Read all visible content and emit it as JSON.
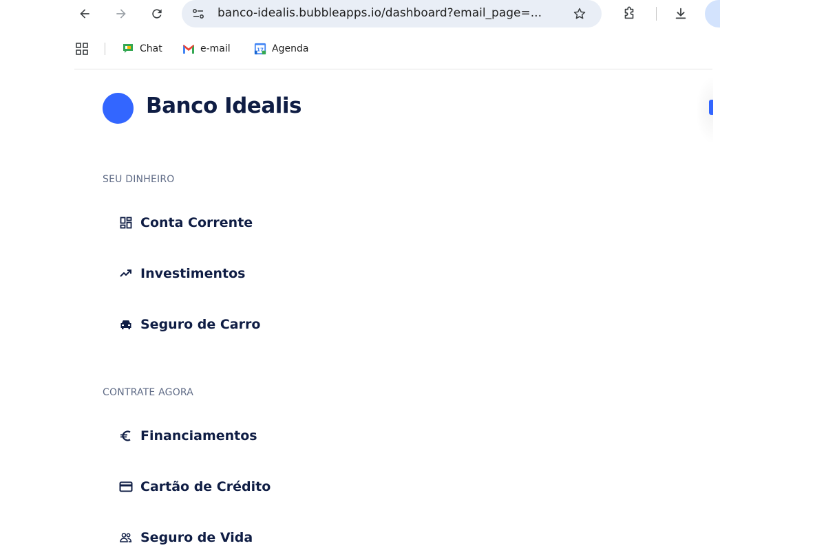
{
  "browser": {
    "url": "banco-idealis.bubbleapps.io/dashboard?email_page=...",
    "bookmarks": [
      {
        "label": "Chat",
        "icon": "google-chat-icon"
      },
      {
        "label": "e-mail",
        "icon": "gmail-icon"
      },
      {
        "label": "Agenda",
        "icon": "calendar-icon"
      }
    ],
    "calendar_day": "17"
  },
  "app": {
    "brand_name": "Banco Idealis",
    "brand_color": "#3366ff",
    "text_color": "#0f1d44"
  },
  "sidebar": {
    "sections": [
      {
        "title": "SEU DINHEIRO",
        "items": [
          {
            "label": "Conta Corrente",
            "icon": "dashboard-grid-icon"
          },
          {
            "label": "Investimentos",
            "icon": "trending-up-icon"
          },
          {
            "label": "Seguro de Carro",
            "icon": "car-icon"
          }
        ]
      },
      {
        "title": "CONTRATE AGORA",
        "items": [
          {
            "label": "Financiamentos",
            "icon": "euro-icon"
          },
          {
            "label": "Cartão de Crédito",
            "icon": "credit-card-icon"
          },
          {
            "label": "Seguro de Vida",
            "icon": "people-icon"
          }
        ]
      }
    ]
  }
}
